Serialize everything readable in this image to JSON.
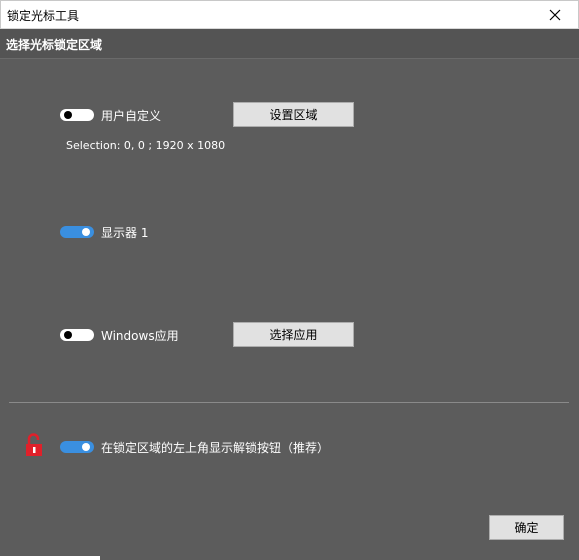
{
  "window": {
    "title": "锁定光标工具"
  },
  "header": {
    "title": "选择光标锁定区域"
  },
  "options": {
    "custom": {
      "label": "用户自定义",
      "enabled": false,
      "button_label": "设置区域",
      "selection_text": "Selection: 0, 0 ;  1920 x 1080"
    },
    "display": {
      "label": "显示器 1",
      "enabled": true
    },
    "windows_app": {
      "label": "Windows应用",
      "enabled": false,
      "button_label": "选择应用"
    }
  },
  "unlock_option": {
    "label": "在锁定区域的左上角显示解锁按钮（推荐）",
    "enabled": true,
    "icon": "unlock-icon"
  },
  "footer": {
    "ok_label": "确定"
  },
  "colors": {
    "background": "#5c5c5c",
    "toggle_on": "#3a8fe0",
    "lock_red": "#e0202a"
  }
}
